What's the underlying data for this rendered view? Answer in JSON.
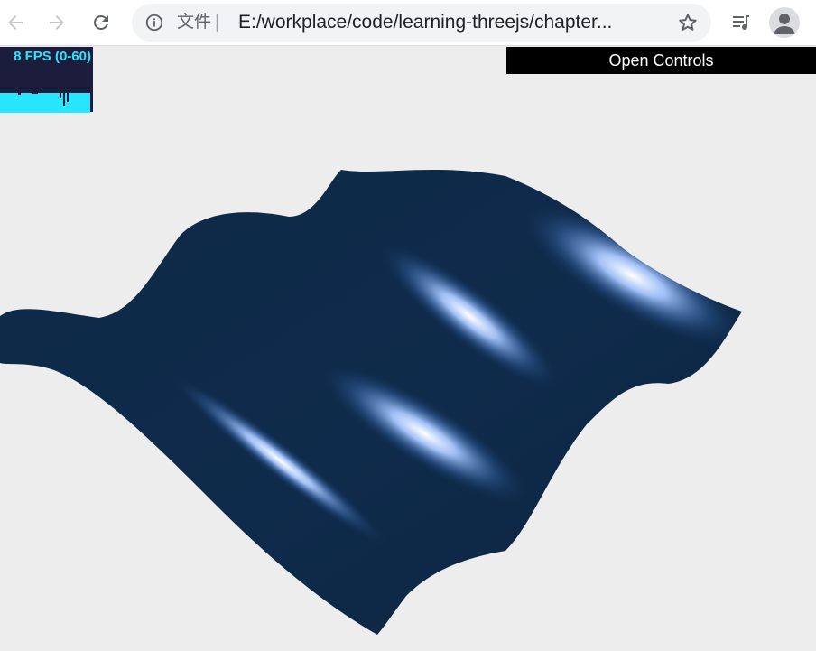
{
  "browser": {
    "file_label": "文件",
    "separator": "|",
    "url": "E:/workplace/code/learning-threejs/chapter...",
    "icons": {
      "back": "arrow-left-icon",
      "forward": "arrow-right-icon",
      "reload": "reload-icon",
      "info": "info-icon",
      "bookmark": "star-icon",
      "media": "media-control-icon",
      "profile": "avatar-icon"
    }
  },
  "stats": {
    "fps_text": "8 FPS (0-60)",
    "color": "#28e6ff"
  },
  "controls": {
    "open_label": "Open Controls"
  },
  "scene": {
    "description_color": "#0f2a4a",
    "highlight_color": "#a8c8ff"
  }
}
